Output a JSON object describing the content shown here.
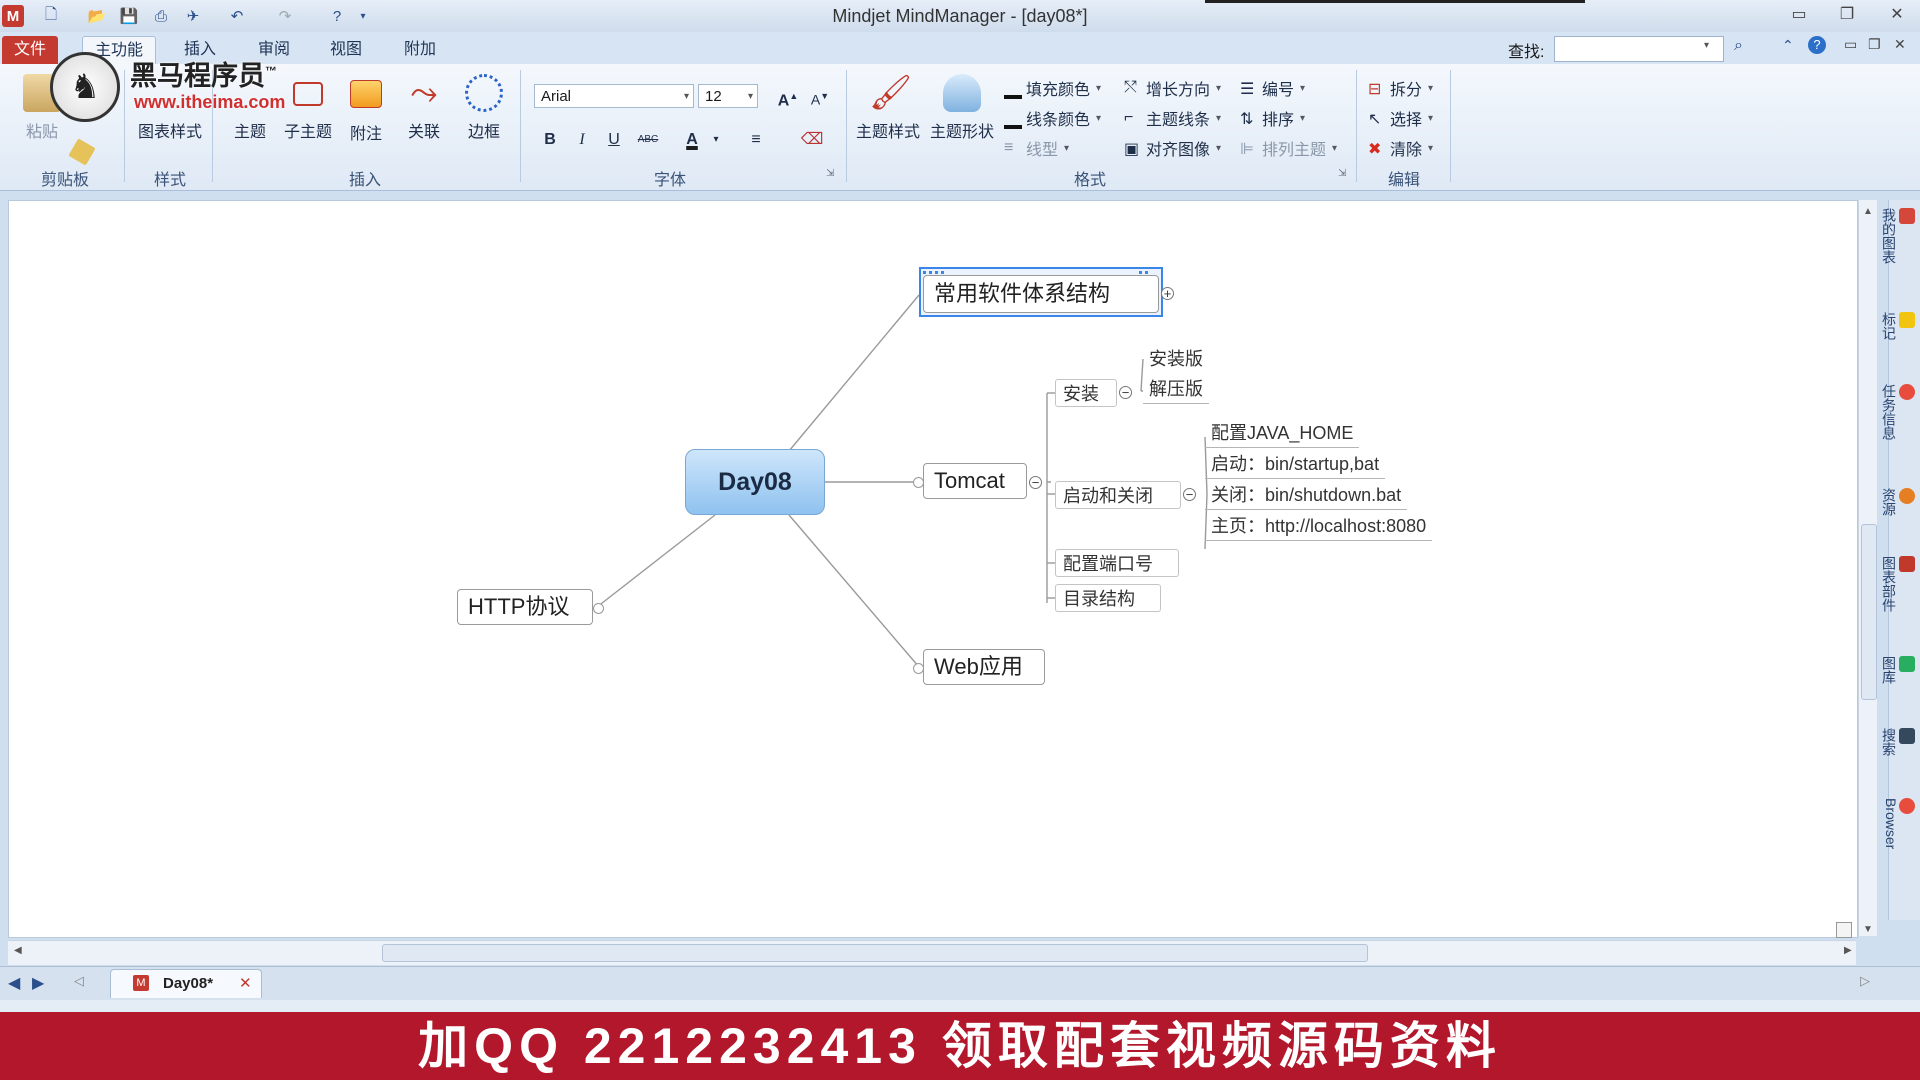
{
  "window": {
    "title": "Mindjet MindManager - [day08*]"
  },
  "tabs": [
    {
      "label": "文件"
    },
    {
      "label": "主功能"
    },
    {
      "label": "插入"
    },
    {
      "label": "审阅"
    },
    {
      "label": "视图"
    },
    {
      "label": "附加"
    }
  ],
  "search": {
    "label": "查找:",
    "value": ""
  },
  "watermark": {
    "brand": "黑马程序员",
    "tm": "™",
    "url": "www.itheima.com"
  },
  "ribbon": {
    "clipboard": {
      "paste": "粘贴",
      "group": "剪贴板"
    },
    "style": {
      "map_style": "图表样式",
      "group": "样式"
    },
    "insert": {
      "topic": "主题",
      "subtopic": "子主题",
      "callout": "附注",
      "relationship": "关联",
      "boundary": "边框",
      "group": "插入"
    },
    "font": {
      "family": "Arial",
      "size": "12",
      "bold": "B",
      "italic": "I",
      "underline": "U",
      "strike": "ABC",
      "color": "A",
      "group": "字体"
    },
    "format": {
      "topic_style": "主题样式",
      "topic_shape": "主题形状",
      "fill_color": "填充颜色",
      "line_color": "线条颜色",
      "line_style": "线型",
      "growth_direction": "增长方向",
      "topic_lines": "主题线条",
      "align_image": "对齐图像",
      "numbering": "编号",
      "sort": "排序",
      "arrange_topics": "排列主题",
      "group": "格式"
    },
    "edit": {
      "split": "拆分",
      "select": "选择",
      "clear": "清除",
      "group": "编辑"
    }
  },
  "map": {
    "central": "Day08",
    "main_topics": {
      "software": "常用软件体系结构",
      "tomcat": "Tomcat",
      "http": "HTTP协议",
      "webapp": "Web应用"
    },
    "tomcat_children": {
      "install": "安装",
      "startstop": "启动和关闭",
      "port": "配置端口号",
      "dirs": "目录结构"
    },
    "install_children": [
      "安装版",
      "解压版"
    ],
    "startstop_children": [
      "配置JAVA_HOME",
      "启动：bin/startup,bat",
      "关闭：bin/shutdown.bat",
      "主页：http://localhost:8080"
    ]
  },
  "dock": [
    "我的图表",
    "标记",
    "任务信息",
    "资源",
    "图表部件",
    "图库",
    "搜索",
    "Browser"
  ],
  "doc_tab": {
    "label": "Day08*"
  },
  "banner": {
    "text": "加QQ 2212232413  领取配套视频源码资料"
  }
}
